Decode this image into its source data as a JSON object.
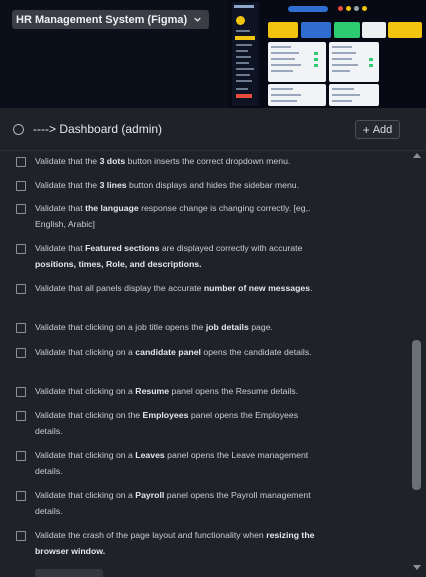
{
  "board": {
    "title": "HR Management System (Figma)"
  },
  "card": {
    "title": "----> Dashboard (admin)",
    "add_label": "Add"
  },
  "checklist": [
    {
      "parts": [
        [
          "Validate that the ",
          false
        ],
        [
          "3 dots",
          true
        ],
        [
          " button inserts the correct dropdown menu.",
          false
        ]
      ]
    },
    {
      "parts": [
        [
          "Validate that the ",
          false
        ],
        [
          "3 lines",
          true
        ],
        [
          " button displays and hides the sidebar menu.",
          false
        ]
      ]
    },
    {
      "parts": [
        [
          "Validate that ",
          false
        ],
        [
          "the language",
          true
        ],
        [
          " response change is changing correctly. [eg,. English, Arabic]",
          false
        ]
      ]
    },
    {
      "parts": [
        [
          "Validate that ",
          false
        ],
        [
          "Featured sections",
          true
        ],
        [
          " are displayed correctly with accurate ",
          false
        ],
        [
          "positions, times, Role, and descriptions.",
          true
        ]
      ]
    },
    {
      "parts": [
        [
          "Validate that all panels display the accurate ",
          false
        ],
        [
          "number of new messages",
          true
        ],
        [
          ".",
          false
        ]
      ]
    },
    {
      "parts": [
        [
          "Validate that clicking on a job title opens the ",
          false
        ],
        [
          "job details",
          true
        ],
        [
          " page.",
          false
        ]
      ]
    },
    {
      "parts": [
        [
          "Validate that clicking on a ",
          false
        ],
        [
          "candidate panel",
          true
        ],
        [
          " opens the candidate details.",
          false
        ]
      ]
    },
    {
      "parts": [
        [
          "Validate that clicking on a ",
          false
        ],
        [
          "Resume",
          true
        ],
        [
          " panel opens the Resume details.",
          false
        ]
      ]
    },
    {
      "parts": [
        [
          "Validate that clicking on the ",
          false
        ],
        [
          "Employees",
          true
        ],
        [
          " panel opens the Employees details.",
          false
        ]
      ]
    },
    {
      "parts": [
        [
          "Validate that clicking on a ",
          false
        ],
        [
          "Leaves",
          true
        ],
        [
          " panel opens the Leave management details.",
          false
        ]
      ]
    },
    {
      "parts": [
        [
          "Validate that clicking on a ",
          false
        ],
        [
          "Payroll",
          true
        ],
        [
          " panel opens the Payroll management details.",
          false
        ]
      ]
    },
    {
      "parts": [
        [
          "Validate the crash of the page layout and functionality when ",
          false
        ],
        [
          "resizing the browser window.",
          true
        ]
      ]
    }
  ],
  "colors": {
    "background": "#1f2226",
    "accent_yellow": "#f1c40f",
    "accent_blue": "#2f6dd1",
    "accent_green": "#2ecc71"
  },
  "icons": {
    "board_menu": "chevron-down-icon",
    "status": "circle-icon",
    "add": "plus-icon",
    "item": "checkbox-icon"
  }
}
